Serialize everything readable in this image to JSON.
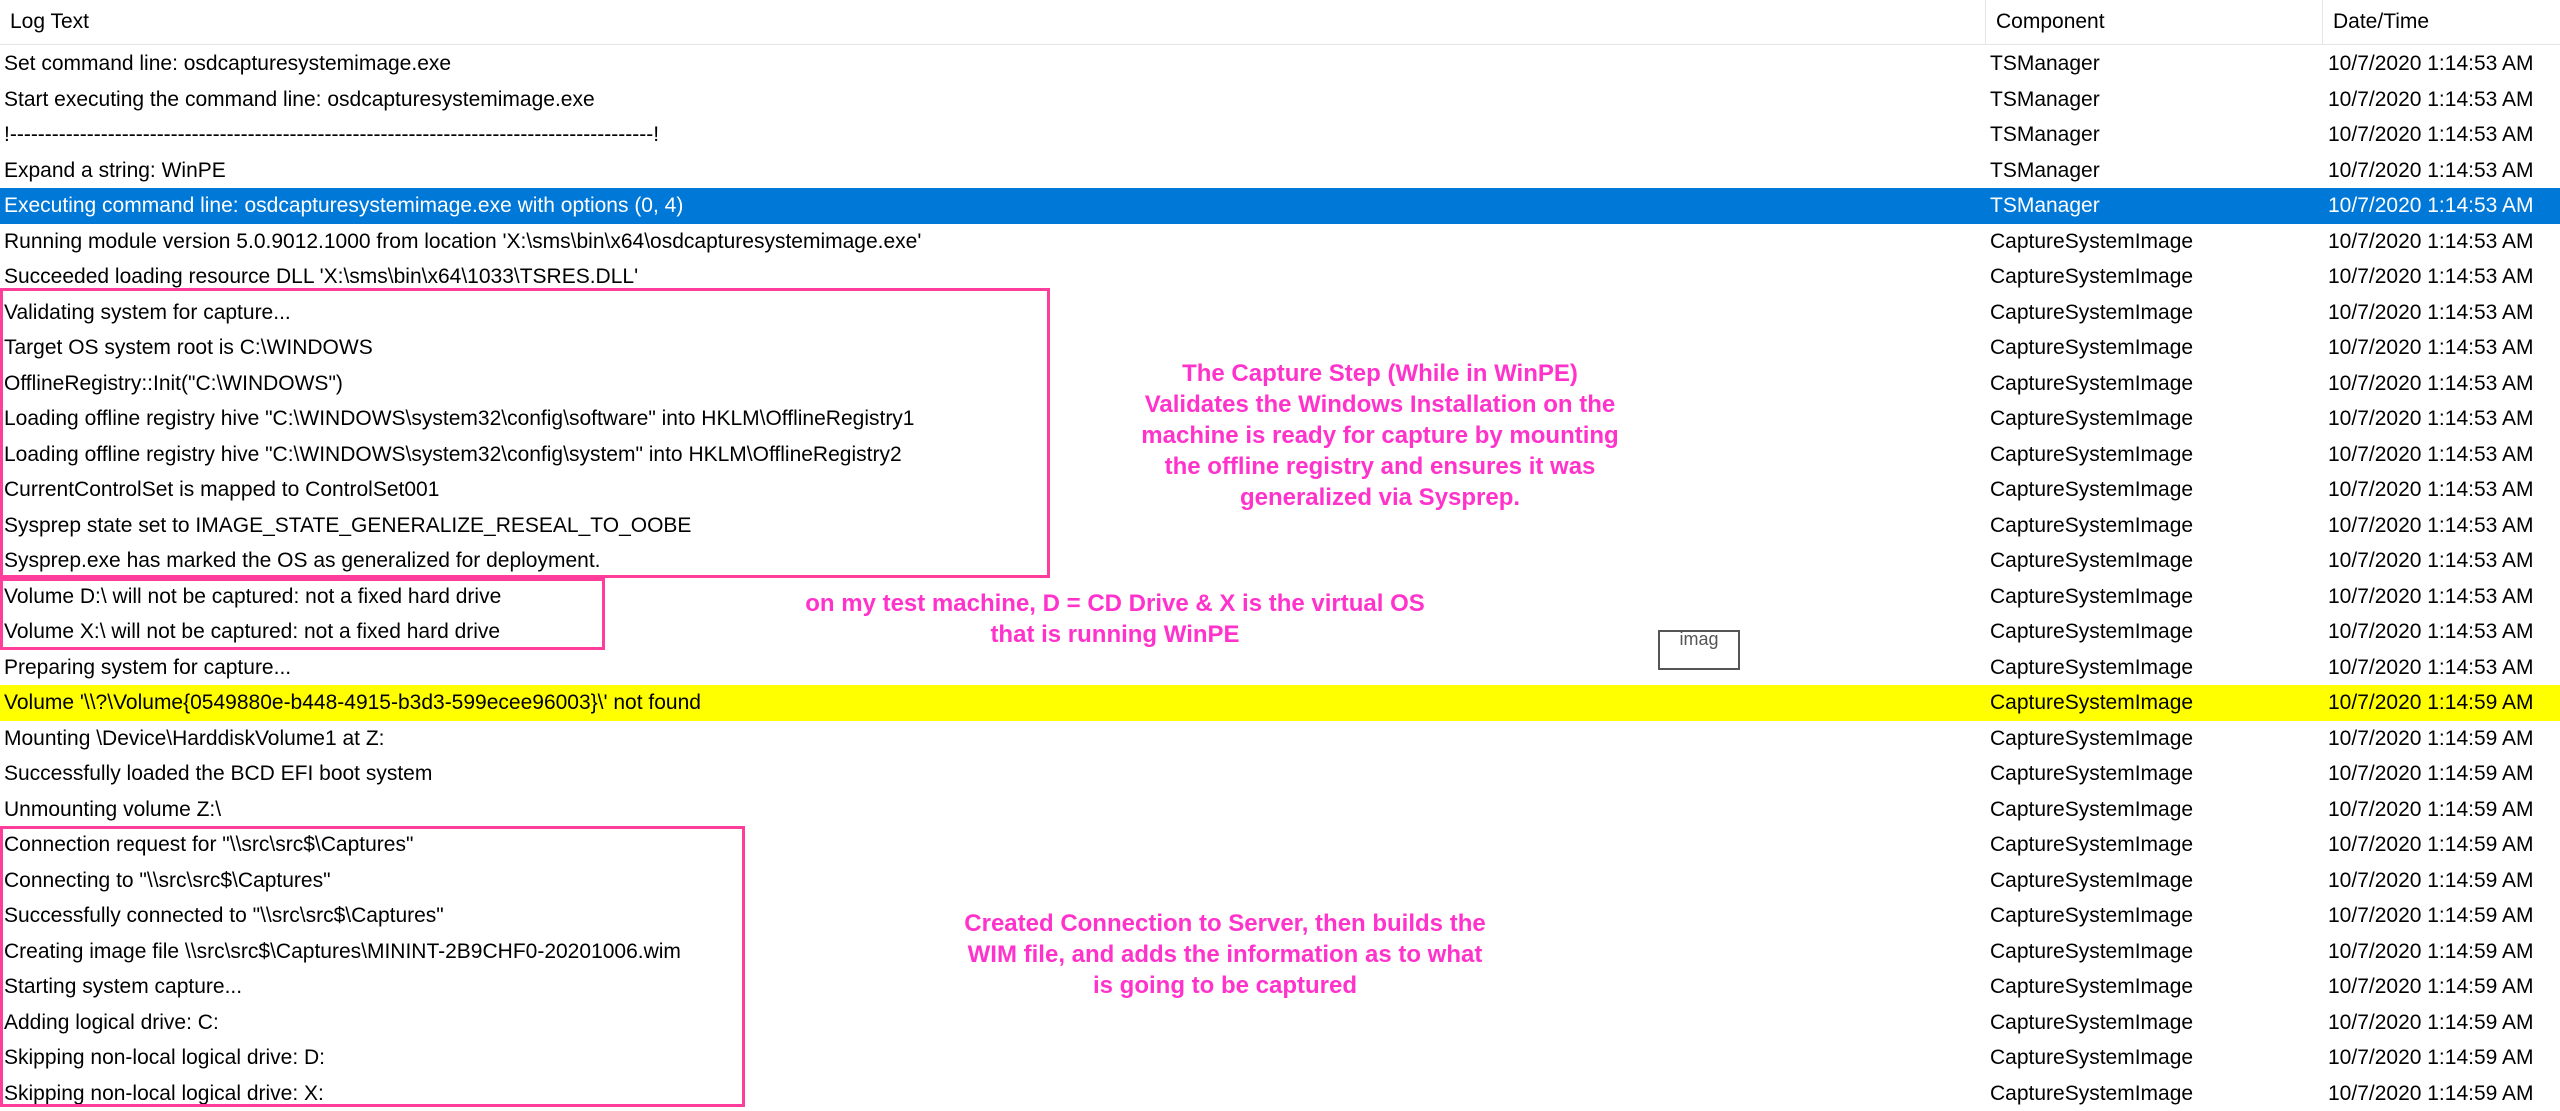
{
  "columns": {
    "log_text": "Log Text",
    "component": "Component",
    "datetime": "Date/Time"
  },
  "rows": [
    {
      "text": "Set command line: osdcapturesystemimage.exe",
      "component": "TSManager",
      "datetime": "10/7/2020 1:14:53 AM"
    },
    {
      "text": "Start executing the command line: osdcapturesystemimage.exe",
      "component": "TSManager",
      "datetime": "10/7/2020 1:14:53 AM"
    },
    {
      "text": "!--------------------------------------------------------------------------------------------!",
      "component": "TSManager",
      "datetime": "10/7/2020 1:14:53 AM"
    },
    {
      "text": "Expand a string: WinPE",
      "component": "TSManager",
      "datetime": "10/7/2020 1:14:53 AM"
    },
    {
      "text": "Executing command line: osdcapturesystemimage.exe with options (0, 4)",
      "component": "TSManager",
      "datetime": "10/7/2020 1:14:53 AM",
      "state": "selected"
    },
    {
      "text": "Running module version 5.0.9012.1000 from location 'X:\\sms\\bin\\x64\\osdcapturesystemimage.exe'",
      "component": "CaptureSystemImage",
      "datetime": "10/7/2020 1:14:53 AM"
    },
    {
      "text": "Succeeded loading resource DLL 'X:\\sms\\bin\\x64\\1033\\TSRES.DLL'",
      "component": "CaptureSystemImage",
      "datetime": "10/7/2020 1:14:53 AM"
    },
    {
      "text": "Validating system for capture...",
      "component": "CaptureSystemImage",
      "datetime": "10/7/2020 1:14:53 AM"
    },
    {
      "text": "Target OS system root is C:\\WINDOWS",
      "component": "CaptureSystemImage",
      "datetime": "10/7/2020 1:14:53 AM"
    },
    {
      "text": "OfflineRegistry::Init(\"C:\\WINDOWS\")",
      "component": "CaptureSystemImage",
      "datetime": "10/7/2020 1:14:53 AM"
    },
    {
      "text": "Loading offline registry hive \"C:\\WINDOWS\\system32\\config\\software\" into HKLM\\OfflineRegistry1",
      "component": "CaptureSystemImage",
      "datetime": "10/7/2020 1:14:53 AM"
    },
    {
      "text": "Loading offline registry hive \"C:\\WINDOWS\\system32\\config\\system\" into HKLM\\OfflineRegistry2",
      "component": "CaptureSystemImage",
      "datetime": "10/7/2020 1:14:53 AM"
    },
    {
      "text": "CurrentControlSet is mapped to ControlSet001",
      "component": "CaptureSystemImage",
      "datetime": "10/7/2020 1:14:53 AM"
    },
    {
      "text": "Sysprep state set to IMAGE_STATE_GENERALIZE_RESEAL_TO_OOBE",
      "component": "CaptureSystemImage",
      "datetime": "10/7/2020 1:14:53 AM"
    },
    {
      "text": "Sysprep.exe has marked the OS as generalized for deployment.",
      "component": "CaptureSystemImage",
      "datetime": "10/7/2020 1:14:53 AM"
    },
    {
      "text": "Volume D:\\ will not be captured: not a fixed hard drive",
      "component": "CaptureSystemImage",
      "datetime": "10/7/2020 1:14:53 AM"
    },
    {
      "text": "Volume X:\\ will not be captured: not a fixed hard drive",
      "component": "CaptureSystemImage",
      "datetime": "10/7/2020 1:14:53 AM"
    },
    {
      "text": "Preparing system for capture...",
      "component": "CaptureSystemImage",
      "datetime": "10/7/2020 1:14:53 AM"
    },
    {
      "text": "Volume '\\\\?\\Volume{0549880e-b448-4915-b3d3-599ecee96003}\\' not found",
      "component": "CaptureSystemImage",
      "datetime": "10/7/2020 1:14:59 AM",
      "state": "warning"
    },
    {
      "text": "Mounting \\Device\\HarddiskVolume1 at Z:",
      "component": "CaptureSystemImage",
      "datetime": "10/7/2020 1:14:59 AM"
    },
    {
      "text": "Successfully loaded the BCD EFI boot system",
      "component": "CaptureSystemImage",
      "datetime": "10/7/2020 1:14:59 AM"
    },
    {
      "text": "Unmounting volume Z:\\",
      "component": "CaptureSystemImage",
      "datetime": "10/7/2020 1:14:59 AM"
    },
    {
      "text": "Connection request for \"\\\\src\\src$\\Captures\"",
      "component": "CaptureSystemImage",
      "datetime": "10/7/2020 1:14:59 AM"
    },
    {
      "text": "Connecting to \"\\\\src\\src$\\Captures\"",
      "component": "CaptureSystemImage",
      "datetime": "10/7/2020 1:14:59 AM"
    },
    {
      "text": "Successfully connected to \"\\\\src\\src$\\Captures\"",
      "component": "CaptureSystemImage",
      "datetime": "10/7/2020 1:14:59 AM"
    },
    {
      "text": "Creating image file \\\\src\\src$\\Captures\\MININT-2B9CHF0-20201006.wim",
      "component": "CaptureSystemImage",
      "datetime": "10/7/2020 1:14:59 AM"
    },
    {
      "text": "Starting system capture...",
      "component": "CaptureSystemImage",
      "datetime": "10/7/2020 1:14:59 AM"
    },
    {
      "text": "Adding logical drive: C:",
      "component": "CaptureSystemImage",
      "datetime": "10/7/2020 1:14:59 AM"
    },
    {
      "text": "Skipping non-local logical drive: D:",
      "component": "CaptureSystemImage",
      "datetime": "10/7/2020 1:14:59 AM"
    },
    {
      "text": "Skipping non-local logical drive: X:",
      "component": "CaptureSystemImage",
      "datetime": "10/7/2020 1:14:59 AM"
    }
  ],
  "annotations": {
    "validate_note": "The Capture Step (While in WinPE)\nValidates the Windows Installation on the\nmachine is ready for capture by mounting\nthe offline registry and ensures it was\ngeneralized via Sysprep.",
    "drive_note": "on my test machine, D = CD Drive & X is the virtual OS\nthat is running WinPE",
    "connection_note": "Created Connection to Server, then builds the\nWIM file, and adds the information as to what\nis going to be captured",
    "ghost_text": "imag",
    "color": "#ff33cc"
  },
  "colors": {
    "selected_row": "#0078d7",
    "warning_row": "#ffff00",
    "annotation_box": "#ff3d9a"
  }
}
